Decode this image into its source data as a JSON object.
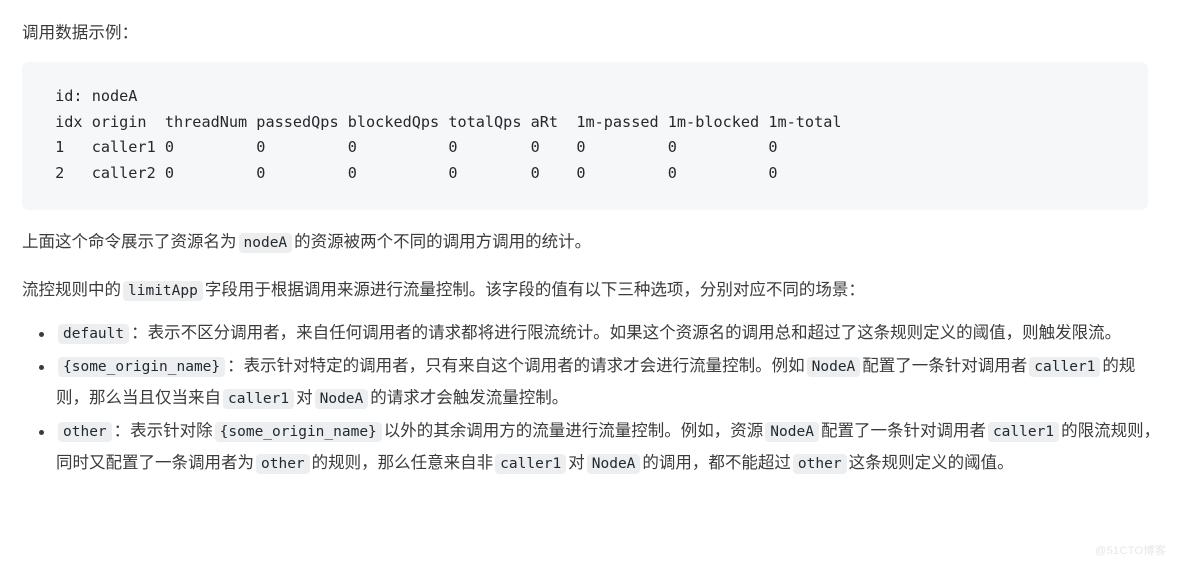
{
  "intro": {
    "text": "调用数据示例："
  },
  "code_block": {
    "language": "text",
    "background": "#f6f7f9",
    "lines": [
      " id: nodeA",
      " idx origin  threadNum passedQps blockedQps totalQps aRt  1m-passed 1m-blocked 1m-total",
      " 1   caller1 0         0         0          0        0    0         0          0",
      " 2   caller2 0         0         0          0        0    0         0          0"
    ],
    "columns": [
      "idx",
      "origin",
      "threadNum",
      "passedQps",
      "blockedQps",
      "totalQps",
      "aRt",
      "1m-passed",
      "1m-blocked",
      "1m-total"
    ],
    "id_label": "id: nodeA",
    "rows": [
      [
        "1",
        "caller1",
        "0",
        "0",
        "0",
        "0",
        "0",
        "0",
        "0",
        "0"
      ],
      [
        "2",
        "caller2",
        "0",
        "0",
        "0",
        "0",
        "0",
        "0",
        "0",
        "0"
      ]
    ]
  },
  "paragraph_1": {
    "part_1": "上面这个命令展示了资源名为",
    "code_1": "nodeA",
    "part_2": "的资源被两个不同的调用方调用的统计。"
  },
  "paragraph_2": {
    "part_1": "流控规则中的",
    "code_1": "limitApp",
    "part_2": "字段用于根据调用来源进行流量控制。该字段的值有以下三种选项，分别对应不同的场景："
  },
  "bullets": [
    {
      "code_1": "default",
      "text_1": "：表示不区分调用者，来自任何调用者的请求都将进行限流统计。如果这个资源名的调用总和超过了这条规则定义的阈值，则触发限流。"
    },
    {
      "code_1": "{some_origin_name}",
      "text_1": "：表示针对特定的调用者，只有来自这个调用者的请求才会进行流量控制。例如",
      "code_2": "NodeA",
      "text_2": "配置了一条针对调用者",
      "code_3": "caller1",
      "text_3": "的规则，那么当且仅当来自",
      "code_4": "caller1",
      "text_4": "对",
      "code_5": "NodeA",
      "text_5": "的请求才会触发流量控制。"
    },
    {
      "code_1": "other",
      "text_1": "：表示针对除",
      "code_2": "{some_origin_name}",
      "text_2": "以外的其余调用方的流量进行流量控制。例如，资源",
      "code_3": "NodeA",
      "text_3": "配置了一条针对调用者",
      "code_4": "caller1",
      "text_4": "的限流规则，同时又配置了一条调用者为",
      "code_5": "other",
      "text_5": "的规则，那么任意来自非",
      "code_6": "caller1",
      "text_6": "对",
      "code_7": "NodeA",
      "text_7": "的调用，都不能超过",
      "code_8": "other",
      "text_8": "这条规则定义的阈值。"
    }
  ],
  "watermark": {
    "text": "@51CTO博客"
  }
}
